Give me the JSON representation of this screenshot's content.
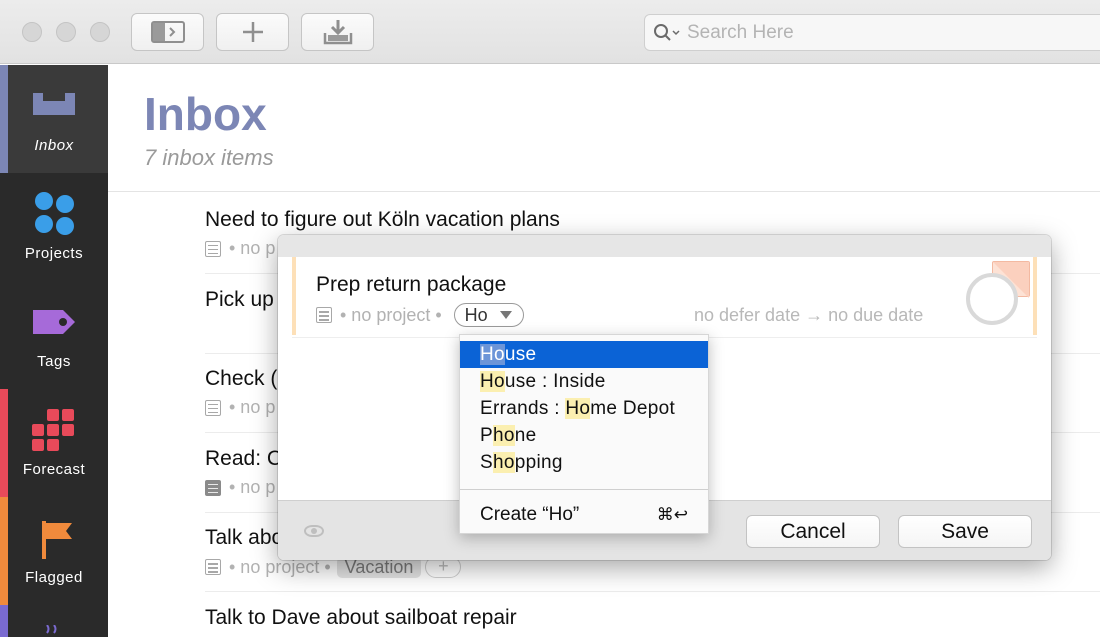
{
  "toolbar": {
    "search_placeholder": "Search Here",
    "sidebar_toggle_icon": "sidebar-toggle-icon",
    "add_icon": "plus-icon",
    "inbox_capture_icon": "download-tray-icon"
  },
  "sidebar": {
    "items": [
      {
        "label": "Inbox",
        "icon": "inbox-tray-icon",
        "color": "#7c86b5"
      },
      {
        "label": "Projects",
        "icon": "projects-dots-icon",
        "color": "#3a9ee8"
      },
      {
        "label": "Tags",
        "icon": "tag-icon",
        "color": "#a66ad9"
      },
      {
        "label": "Forecast",
        "icon": "forecast-grid-icon",
        "color": "#e84a5a"
      },
      {
        "label": "Flagged",
        "icon": "flag-icon",
        "color": "#f08a3c"
      }
    ]
  },
  "header": {
    "title": "Inbox",
    "subtitle": "7 inbox items"
  },
  "tasks": [
    {
      "title": "Need to figure out Köln vacation plans",
      "meta": "• no p"
    },
    {
      "title": "Pick up",
      "meta": ""
    },
    {
      "title": "Check (",
      "meta": "• no p"
    },
    {
      "title": "Read: C",
      "meta": "• no p"
    },
    {
      "title": "Talk abo",
      "meta": "• no project •",
      "tag": "Vacation",
      "tag_add": "+"
    },
    {
      "title": "Talk to Dave about sailboat repair",
      "meta": ""
    }
  ],
  "editor": {
    "title": "Prep return package",
    "meta": "• no project •",
    "tag_input": "Ho",
    "defer": "no defer date",
    "arrow": "→",
    "due": "no due date",
    "cancel_label": "Cancel",
    "save_label": "Save"
  },
  "dropdown": {
    "items": [
      {
        "pre": "",
        "match": "Ho",
        "post": "use"
      },
      {
        "pre": "",
        "match": "Ho",
        "post": "use : Inside"
      },
      {
        "pre": "Errands : ",
        "match": "Ho",
        "post": "me Depot"
      },
      {
        "pre": "P",
        "match": "ho",
        "post": "ne"
      },
      {
        "pre": "S",
        "match": "ho",
        "post": "pping"
      }
    ],
    "create_label": "Create “Ho”",
    "create_shortcut": "⌘↩"
  }
}
